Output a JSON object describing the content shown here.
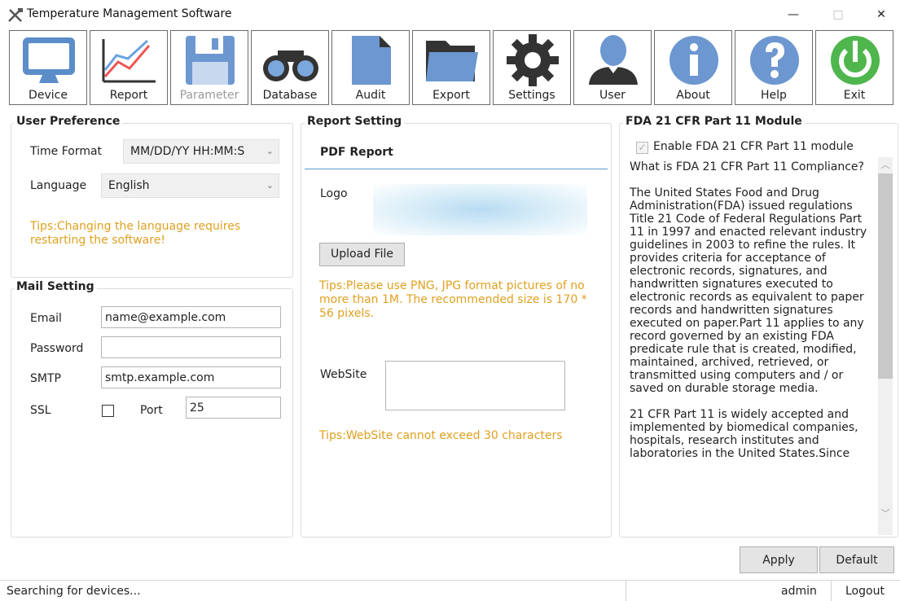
{
  "window": {
    "title": "Temperature Management Software",
    "min": "—",
    "max": "□",
    "close": "✕"
  },
  "toolbar": [
    {
      "label": "Device",
      "icon": "monitor-icon"
    },
    {
      "label": "Report",
      "icon": "chart-icon"
    },
    {
      "label": "Parameter",
      "icon": "floppy-icon",
      "disabled": true
    },
    {
      "label": "Database",
      "icon": "binoculars-icon"
    },
    {
      "label": "Audit",
      "icon": "document-icon"
    },
    {
      "label": "Export",
      "icon": "folder-icon"
    },
    {
      "label": "Settings",
      "icon": "gear-icon"
    },
    {
      "label": "User",
      "icon": "user-icon"
    },
    {
      "label": "About",
      "icon": "info-icon"
    },
    {
      "label": "Help",
      "icon": "question-icon"
    },
    {
      "label": "Exit",
      "icon": "power-icon"
    }
  ],
  "user_pref": {
    "title": "User Preference",
    "time_format_label": "Time Format",
    "time_format_value": "MM/DD/YY HH:MM:S",
    "language_label": "Language",
    "language_value": "English",
    "tips": "Tips:Changing the language requires restarting the software!"
  },
  "mail": {
    "title": "Mail Setting",
    "email_label": "Email",
    "email_value": "name@example.com",
    "password_label": "Password",
    "password_value": "",
    "smtp_label": "SMTP",
    "smtp_value": "smtp.example.com",
    "ssl_label": "SSL",
    "ssl_checked": false,
    "port_label": "Port",
    "port_value": "25"
  },
  "report": {
    "title": "Report Setting",
    "tab": "PDF Report",
    "logo_label": "Logo",
    "upload_button": "Upload File",
    "logo_tips": "Tips:Please use PNG, JPG format pictures of no more than 1M. The recommended size is 170 * 56 pixels.",
    "website_label": "WebSite",
    "website_value": "",
    "website_tips": "Tips:WebSite cannot exceed 30 characters"
  },
  "fda": {
    "title": "FDA 21 CFR Part 11 Module",
    "enable_label": "Enable FDA 21 CFR Part 11 module",
    "enable_checked": true,
    "paragraphs": [
      "What is FDA 21 CFR Part 11 Compliance?",
      "The United States Food and Drug Administration(FDA) issued regulations Title 21 Code of Federal Regulations Part 11 in 1997 and enacted relevant industry guidelines in 2003 to refine the rules. It provides criteria for acceptance of electronic records, signatures, and handwritten signatures executed to electronic records as equivalent to paper records and handwritten signatures executed on paper.Part 11 applies to any record governed by an existing FDA predicate rule that is created, modified, maintained, archived, retrieved, or transmitted using computers and / or saved on durable storage media.",
      "21 CFR Part 11 is widely accepted and implemented by biomedical companies, hospitals, research institutes and laboratories in the United States.Since"
    ]
  },
  "actions": {
    "apply": "Apply",
    "default": "Default"
  },
  "status": {
    "text": "Searching for devices...",
    "user": "admin",
    "logout": "Logout"
  }
}
